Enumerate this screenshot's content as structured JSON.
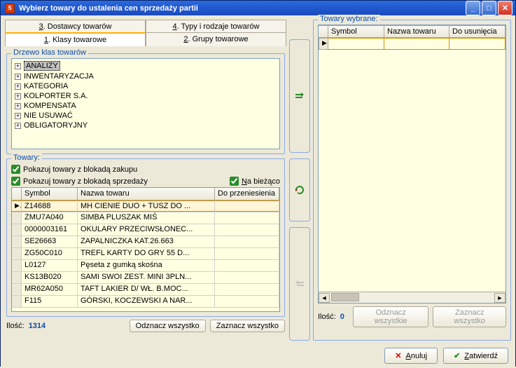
{
  "window": {
    "title": "Wybierz towary do ustalenia cen sprzedaży partii"
  },
  "tabs": {
    "row1": [
      {
        "label_u": "3",
        "label_rest": ". Dostawcy towarów"
      },
      {
        "label_u": "4",
        "label_rest": ". Typy i rodzaje towarów"
      }
    ],
    "row2": [
      {
        "label_u": "1",
        "label_rest": ". Klasy towarowe",
        "active": true
      },
      {
        "label_u": "2",
        "label_rest": ". Grupy towarowe"
      }
    ]
  },
  "tree_frame": {
    "title": "Drzewo klas towarów"
  },
  "tree": [
    {
      "label": "ANALIZY",
      "selected": true
    },
    {
      "label": "INWENTARYZACJA"
    },
    {
      "label": "KATEGORIA"
    },
    {
      "label": "KOLPORTER S.A."
    },
    {
      "label": "KOMPENSATA"
    },
    {
      "label": "NIE USUWAĆ"
    },
    {
      "label": "OBLIGATORYJNY"
    }
  ],
  "towary_frame": {
    "title": "Towary:"
  },
  "checks": {
    "blokada_zakupu": "Pokazuj towary z blokadą zakupu",
    "blokada_sprzed": "Pokazuj towary z blokadą sprzedaży",
    "na_biezaco_u": "N",
    "na_biezaco_rest": "a bieżąco"
  },
  "grid": {
    "headers": {
      "symbol": "Symbol",
      "nazwa": "Nazwa towaru",
      "do": "Do przeniesienia"
    },
    "rows": [
      {
        "sym": "Z14688",
        "naz": "MH CIENIE DUO + TUSZ DO ...",
        "selected": true
      },
      {
        "sym": "ZMU7A040",
        "naz": "SIMBA PLUSZAK MIŚ"
      },
      {
        "sym": "0000003161",
        "naz": "OKULARY PRZECIWSŁONEC..."
      },
      {
        "sym": "SE26663",
        "naz": "ZAPALNICZKA KAT.26.663"
      },
      {
        "sym": "ZG50C010",
        "naz": "TREFL KARTY DO GRY 55 D..."
      },
      {
        "sym": "L0127",
        "naz": "Pęseta z gumką skośna"
      },
      {
        "sym": "KS13B020",
        "naz": "SAMI SWOI  ZEST. MINI 3PLN..."
      },
      {
        "sym": "MR62A050",
        "naz": "TAFT LAKIER D/ WŁ. B.MOC..."
      },
      {
        "sym": "F115",
        "naz": "GÓRSKI, KOCZEWSKI A NAR..."
      }
    ]
  },
  "footer_left": {
    "ilosc_label": "Ilość:",
    "ilosc_value": "1314",
    "odznacz": "Odznacz wszystko",
    "zaznacz": "Zaznacz wszystko"
  },
  "right": {
    "frame_title": "Towary wybrane:",
    "headers": {
      "symbol": "Symbol",
      "nazwa": "Nazwa towaru",
      "do": "Do usunięcia"
    }
  },
  "footer_right": {
    "ilosc_label": "Ilość:",
    "ilosc_value": "0",
    "odznacz": "Odznacz wszystkie",
    "zaznacz": "Zaznacz wszystko"
  },
  "buttons": {
    "anuluj_u": "A",
    "anuluj_rest": "nuluj",
    "zatwierdz_u": "Z",
    "zatwierdz_rest": "atwierdź"
  }
}
